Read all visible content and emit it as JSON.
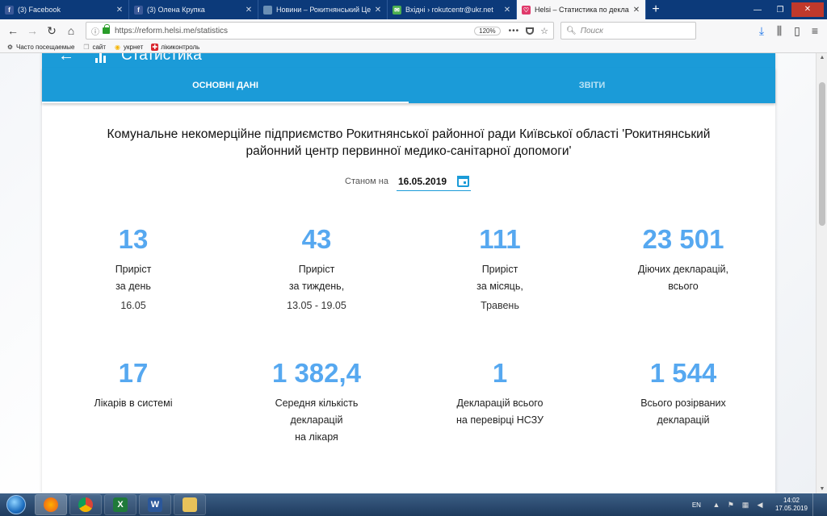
{
  "browser": {
    "tabs": [
      {
        "title": "(3) Facebook",
        "icon": "facebook-icon",
        "color": "#3b5998",
        "glyph": "f",
        "active": false
      },
      {
        "title": "(3) Олена Крупка",
        "icon": "facebook-icon",
        "color": "#3b5998",
        "glyph": "f",
        "active": false
      },
      {
        "title": "Новини – Рокитнянський Цен",
        "icon": "site-icon",
        "color": "#6a8fb5",
        "glyph": "",
        "active": false
      },
      {
        "title": "Вхідні › rokutcentr@ukr.net",
        "icon": "mail-icon",
        "color": "#4caf50",
        "glyph": "✉",
        "active": false
      },
      {
        "title": "Helsi – Статистика по деклара",
        "icon": "helsi-icon",
        "color": "#e03a6b",
        "glyph": "♡",
        "active": true
      }
    ],
    "url": "https://reform.helsi.me/statistics",
    "zoom": "120%",
    "search_placeholder": "Поиск",
    "bookmarks": [
      {
        "label": "Часто посещаемые",
        "icon": "gear-icon"
      },
      {
        "label": "сайт",
        "icon": "bookmark-icon"
      },
      {
        "label": "укрнет",
        "icon": "ukrnet-icon"
      },
      {
        "label": "лікиконтроль",
        "icon": "likicontrol-icon"
      }
    ]
  },
  "app": {
    "title": "Статистика",
    "tabs": {
      "main": "ОСНОВНІ ДАНІ",
      "reports": "ЗВІТИ"
    },
    "organization": {
      "line1": "Комунальне некомерційне підприємство Рокитнянської районної ради Київської області 'Рокитнянський",
      "line2": "районний центр первинної медико-санітарної допомоги'"
    },
    "as_of_label": "Станом на",
    "as_of_date": "16.05.2019",
    "stats": [
      {
        "value": "13",
        "label": "Приріст\nза день",
        "sub": "16.05"
      },
      {
        "value": "43",
        "label": "Приріст\nза тиждень,",
        "sub": "13.05 - 19.05"
      },
      {
        "value": "111",
        "label": "Приріст\nза місяць,",
        "sub": "Травень"
      },
      {
        "value": "23 501",
        "label": "Діючих декларацій,\nвсього",
        "sub": ""
      },
      {
        "value": "17",
        "label": "Лікарів в системі",
        "sub": ""
      },
      {
        "value": "1 382,4",
        "label": "Середня кількість\nдекларацій\nна лікаря",
        "sub": ""
      },
      {
        "value": "1",
        "label": "Декларацій всього\nна перевірці НСЗУ",
        "sub": ""
      },
      {
        "value": "1 544",
        "label": "Всього розірваних\nдекларацій",
        "sub": ""
      }
    ]
  },
  "taskbar": {
    "apps": [
      "firefox-icon",
      "chrome-icon",
      "excel-icon",
      "word-icon",
      "explorer-icon"
    ],
    "language": "EN",
    "time": "14:02",
    "date": "17.05.2019"
  },
  "colors": {
    "accent": "#1b9bd8",
    "stat_number": "#56a8f0"
  }
}
